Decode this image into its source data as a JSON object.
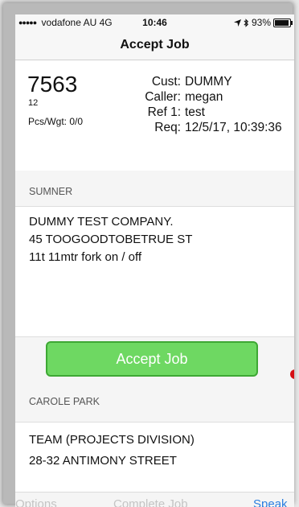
{
  "status_bar": {
    "carrier": "vodafone AU",
    "network": "4G",
    "time": "10:46",
    "battery": "93%"
  },
  "nav": {
    "title": "Accept Job"
  },
  "job": {
    "number": "7563",
    "sub_number": "12",
    "pcs_wgt": "Pcs/Wgt: 0/0",
    "details": [
      {
        "key": "Cust:",
        "value": "DUMMY"
      },
      {
        "key": "Caller:",
        "value": "megan"
      },
      {
        "key": "Ref 1:",
        "value": "test"
      },
      {
        "key": "Req:",
        "value": "12/5/17, 10:39:36"
      }
    ]
  },
  "pickup": {
    "suburb": "SUMNER",
    "lines": [
      "DUMMY TEST COMPANY.",
      "45 TOOGOODTOBETRUE ST",
      "11t 11mtr fork on / off"
    ]
  },
  "accept_button": {
    "label": "Accept Job"
  },
  "delivery": {
    "suburb": "CAROLE PARK",
    "lines": [
      "TEAM (PROJECTS DIVISION)",
      "28-32 ANTIMONY STREET"
    ]
  },
  "toolbar": {
    "options": "Options",
    "complete_job": "Complete Job",
    "speak": "Speak"
  },
  "colors": {
    "accept_fill": "#6ed862",
    "accept_border": "#3ea834",
    "link_blue": "#2b7fe0",
    "disabled_gray": "#c4c4c4",
    "location_dot": "#d50f14"
  }
}
